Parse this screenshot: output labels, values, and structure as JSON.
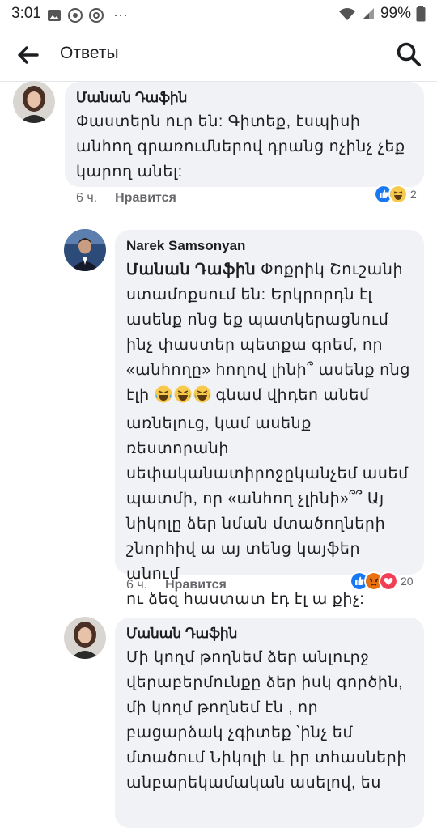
{
  "status_bar": {
    "time": "3:01",
    "battery": "99%",
    "more": "···"
  },
  "header": {
    "title": "Ответы"
  },
  "comments": [
    {
      "author": "Մանան Դաֆին",
      "lines": [
        "Փաստերն ուր են: Գիտեք, էսպիսի",
        "անհող գրառումներով դրանց ոչինչ չեք",
        "կարող անել:"
      ],
      "time": "6 ч.",
      "like_label": "Нравится",
      "reaction_count": "2",
      "reactions": [
        "like",
        "haha"
      ]
    },
    {
      "author": "Narek Samsonyan",
      "mention": "Մանան Դաֆին",
      "line1_rest": " Փոքրիկ Շուշանի",
      "line2": "ստամոքսում են: Երկրորդն էլ",
      "line3": "ասենք ոնց եք պատկերացնում",
      "line4": "ինչ փաստեր պետքա գրեմ, որ",
      "line5": "«անհողը» հողով լինի՞ ասենք ոնց",
      "line6_a": "էլի ",
      "line6_b": " գնամ վիդեո անեմ",
      "line7": "առնելուց, կամ ասենք",
      "line8": "ռեստորանի",
      "line9": "սեփականատիրոջըկանչեմ ասեմ",
      "line10": "պատմի, որ «անհող չլինի»՞՞ Այ",
      "line11": "նիկոլը ձեր նման մտածողների",
      "line12": "շնորհիվ ա այ տենց կայֆեր անում",
      "line13": "ու ձեզ հաստատ էդ էլ ա քիչ:",
      "time": "6 ч.",
      "like_label": "Нравится",
      "reaction_count": "20",
      "reactions": [
        "like",
        "angry",
        "love"
      ]
    },
    {
      "author": "Մանան Դաֆին",
      "lines": [
        "Մի կողմ թողնեմ ձեր անլուրջ",
        "վերաբերմունքը ձեր իսկ գործին,",
        "մի կողմ թողնեմ էն , որ",
        "բացարձակ չգիտեք ՝ինչ եմ",
        "մտածում Նիկոլի և իր տհասների",
        "անբարեկամական ասելով, ես"
      ]
    }
  ],
  "colors": {
    "accent": "#1877f2",
    "bubble": "#f0f2f5",
    "meta": "#65676b"
  }
}
